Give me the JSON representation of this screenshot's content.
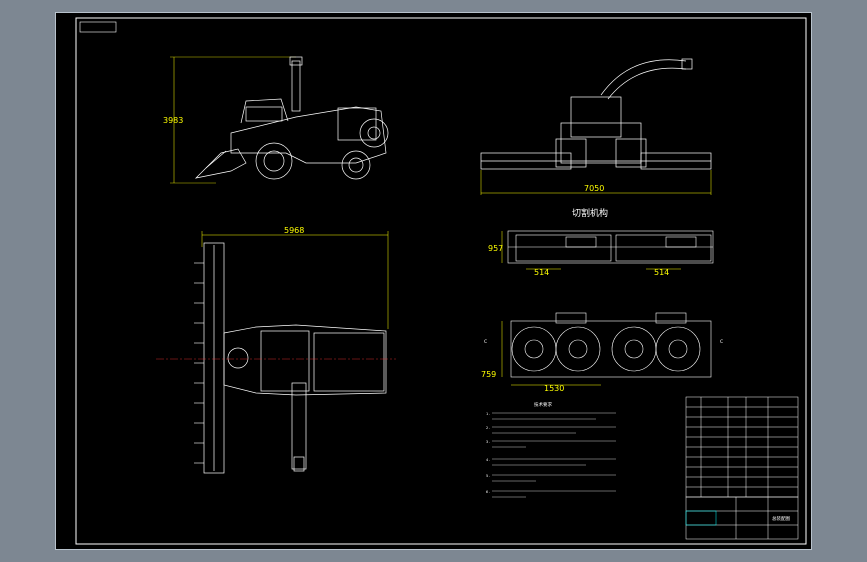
{
  "colors": {
    "background": "#7d8792",
    "sheet": "#000000",
    "linework": "#ffffff",
    "dimension": "#ffff00",
    "centerline": "#ff3030",
    "accent": "#00ffff"
  },
  "dimensions": {
    "side_height": "3983",
    "front_width": "7050",
    "top_length": "5968",
    "detail_height": "957",
    "detail_width_left": "514",
    "detail_width_right": "514",
    "rotor_height": "759",
    "rotor_width": "1530"
  },
  "section_title": "切割机构",
  "section_marks": {
    "c_left": "C",
    "c_right": "C"
  },
  "tech_requirements": {
    "title": "技术要求",
    "lines": [
      "1.",
      "2.",
      "3.",
      "4.",
      "5.",
      "6."
    ]
  },
  "title_block": {
    "drawing_name": "总装配图"
  }
}
